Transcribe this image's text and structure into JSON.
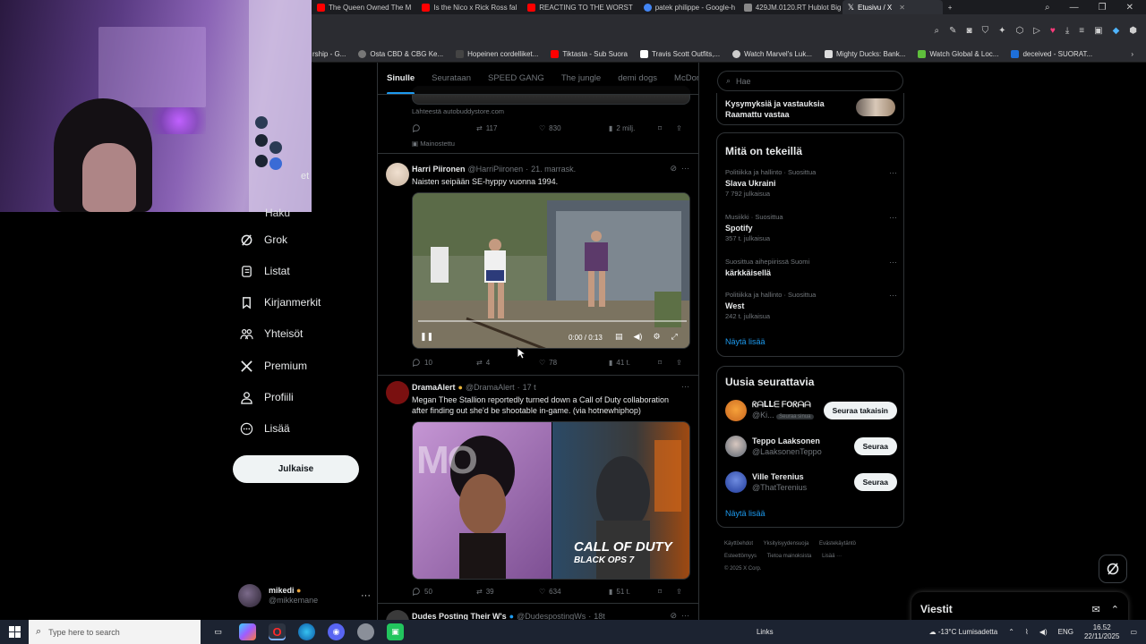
{
  "browser": {
    "tabs": [
      {
        "label": "The Queen Owned The M",
        "color": "#ff0000"
      },
      {
        "label": "Is the Nico x Rick Ross fal",
        "color": "#ff0000"
      },
      {
        "label": "REACTING TO THE WORST",
        "color": "#ff0000"
      },
      {
        "label": "patek philippe - Google-h",
        "color": "#4285f4"
      },
      {
        "label": "429JM.0120.RT Hublot Big",
        "color": "#888888"
      },
      {
        "label": "Etusivu / X",
        "color": "#ffffff",
        "active": true
      }
    ],
    "new_tab": "+",
    "bookmarks": [
      {
        "label": "rship - G..."
      },
      {
        "label": "Osta CBD & CBG Ke..."
      },
      {
        "label": "Hopeinen cordelliket..."
      },
      {
        "label": "Tiktasta - Sub Suora"
      },
      {
        "label": "Travis Scott Outfits,..."
      },
      {
        "label": "Watch Marvel's Luk..."
      },
      {
        "label": "Mighty Ducks: Bank..."
      },
      {
        "label": "Watch Global & Loc..."
      },
      {
        "label": "deceived - SUORAT..."
      }
    ],
    "bookmarks_more": "›"
  },
  "webcam_overlay_text": "et",
  "nav": {
    "partial_item": "Haku",
    "items": [
      {
        "label": "Grok",
        "icon": "grok-icon"
      },
      {
        "label": "Listat",
        "icon": "list-icon"
      },
      {
        "label": "Kirjanmerkit",
        "icon": "bookmark-icon"
      },
      {
        "label": "Yhteisöt",
        "icon": "communities-icon"
      },
      {
        "label": "Premium",
        "icon": "x-logo-icon"
      },
      {
        "label": "Profiili",
        "icon": "profile-icon"
      },
      {
        "label": "Lisää",
        "icon": "more-icon"
      }
    ],
    "post_button": "Julkaise",
    "account": {
      "display_name": "mikedi",
      "username": "@mikkemane",
      "more": "···"
    }
  },
  "feed": {
    "tabs": [
      {
        "label": "Sinulle",
        "active": true
      },
      {
        "label": "Seurataan"
      },
      {
        "label": "SPEED GANG"
      },
      {
        "label": "The jungle"
      },
      {
        "label": "demi dogs"
      },
      {
        "label": "McDonald"
      }
    ],
    "ad_tweet": {
      "source": "Lähteestä autobuddystore.com",
      "replies": "",
      "retweets": "117",
      "likes": "830",
      "views": "2 milj.",
      "promoted": "Mainostettu"
    },
    "tweet1": {
      "name": "Harri Piironen",
      "handle": "@HarriPiironen",
      "time": "21. marrask.",
      "text": "Naisten seipään SE-hyppy vuonna 1994.",
      "video_time": "0:00 / 0:13",
      "replies": "10",
      "retweets": "4",
      "likes": "78",
      "views": "41 t."
    },
    "tweet2": {
      "name": "DramaAlert",
      "handle": "@DramaAlert",
      "time": "17 t",
      "text": "Megan Thee Stallion reportedly turned down a Call of Duty collaboration after finding out she'd be shootable in-game. (via hotnewhiphop)",
      "image_left_text": "MO",
      "image_right_title": "CALL OF DUTY",
      "image_right_subtitle": "BLACK OPS 7",
      "replies": "50",
      "retweets": "39",
      "likes": "634",
      "views": "51 t."
    },
    "tweet3": {
      "name": "Dudes Posting Their W's",
      "handle": "@DudespostingWs",
      "time": "18t"
    }
  },
  "right": {
    "search_placeholder": "Hae",
    "top_card": {
      "line1": "Kysymyksiä ja vastauksia",
      "line2": "Raamattu vastaa"
    },
    "trends_title": "Mitä on tekeillä",
    "trends": [
      {
        "context": "Politiikka ja hallinto · Suosittua",
        "title": "Slava Ukraini",
        "count": "7 792 julkaisua"
      },
      {
        "context": "Musiikki · Suosittua",
        "title": "Spotify",
        "count": "357 t. julkaisua"
      },
      {
        "context": "Suosittua aihepiirissä Suomi",
        "title": "kärkkäisellä",
        "count": ""
      },
      {
        "context": "Politiikka ja hallinto · Suosittua",
        "title": "West",
        "count": "242 t. julkaisua"
      }
    ],
    "show_more": "Näytä lisää",
    "follow_title": "Uusia seurattavia",
    "follows": [
      {
        "name": "ᖇᗩᒪᒪᗴ ᖴOᖇᗩᗩ",
        "handle": "@Ki...",
        "badge": "Seuraa sinua",
        "button": "Seuraa takaisin",
        "color": "#e07a2c"
      },
      {
        "name": "Teppo Laaksonen",
        "handle": "@LaaksonenTeppo",
        "button": "Seuraa",
        "color": "#8a8f96"
      },
      {
        "name": "Ville Terenius",
        "handle": "@ThatTerenius",
        "button": "Seuraa",
        "color": "#2a4fb3"
      }
    ],
    "footer": [
      "Käyttöehdot",
      "Yksityisyydensuoja",
      "Evästekäytäntö",
      "Esteettömyys",
      "Tietoa mainoksista",
      "Lisää ···",
      "© 2025 X Corp."
    ]
  },
  "messages": {
    "label": "Viestit"
  },
  "taskbar": {
    "search_placeholder": "Type here to search",
    "links": "Links",
    "weather": "-13°C Lumisadetta",
    "lang": "ENG",
    "time": "16.52",
    "date": "22/11/2025"
  },
  "colors": {
    "accent": "#1d9bf0",
    "background": "#000000",
    "border": "#2f3336",
    "muted": "#71767b"
  }
}
